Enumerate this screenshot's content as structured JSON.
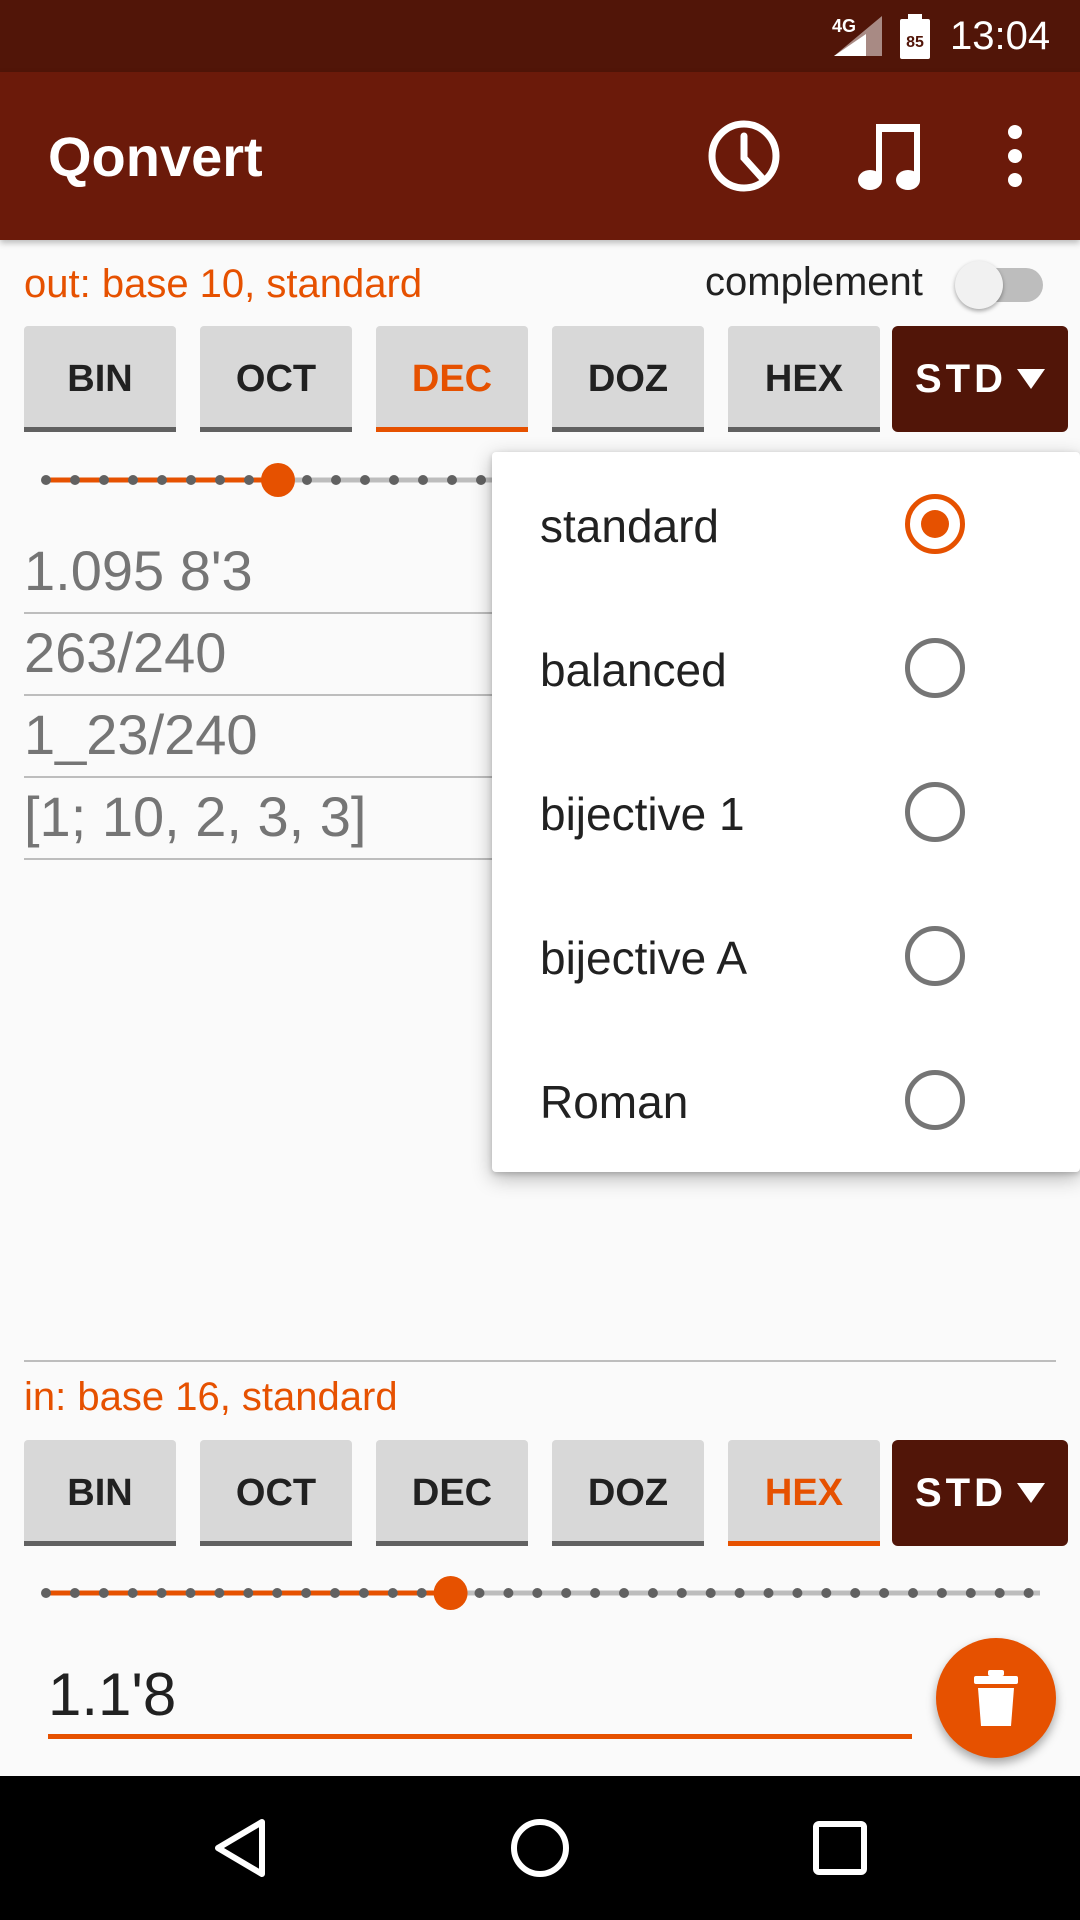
{
  "status_bar": {
    "network": "4G",
    "battery": "85",
    "time": "13:04"
  },
  "app_bar": {
    "title": "Qonvert",
    "icons": [
      "history-icon",
      "music-icon",
      "more-vert-icon"
    ]
  },
  "output": {
    "label": "out: base 10, standard",
    "complement_label": "complement",
    "complement_on": false,
    "bases": [
      "BIN",
      "OCT",
      "DEC",
      "DOZ",
      "HEX"
    ],
    "selected_base": "DEC",
    "system_button": "STD",
    "precision_slider": {
      "steps": 16,
      "value": 8
    },
    "results": [
      "1.095 8'3",
      "263/240",
      "1_23/240",
      "[1; 10, 2, 3, 3]"
    ]
  },
  "input": {
    "label": "in: base 16, standard",
    "bases": [
      "BIN",
      "OCT",
      "DEC",
      "DOZ",
      "HEX"
    ],
    "selected_base": "HEX",
    "system_button": "STD",
    "precision_slider": {
      "steps": 35,
      "value": 14
    },
    "value": "1.1'8"
  },
  "system_menu": {
    "options": [
      "standard",
      "balanced",
      "bijective 1",
      "bijective A",
      "Roman"
    ],
    "selected": "standard"
  },
  "colors": {
    "accent": "#e65100",
    "app_bar": "#6b1a0a",
    "status_bar": "#511508"
  }
}
